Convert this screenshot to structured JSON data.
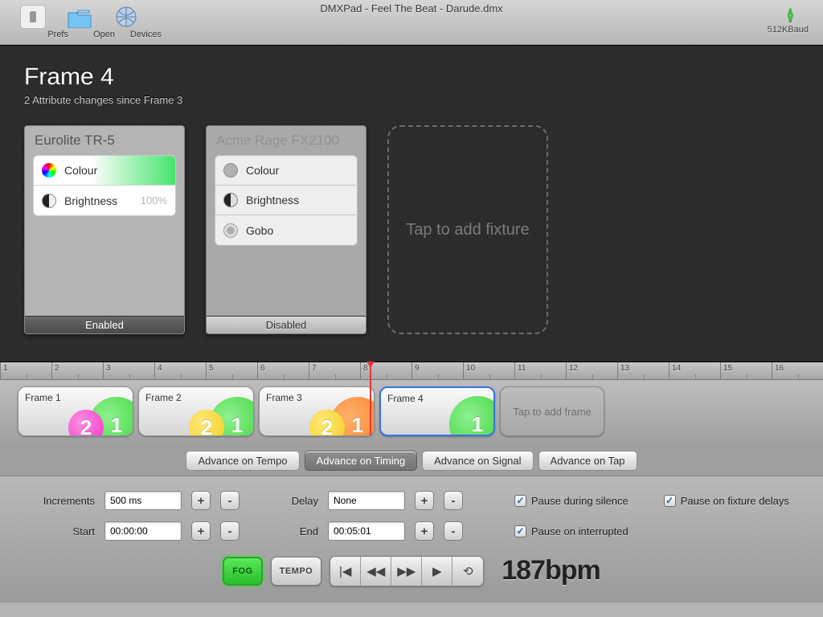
{
  "window": {
    "title": "DMXPad - Feel The Beat - Darude.dmx"
  },
  "toolbar": {
    "prefs": "Prefs",
    "open": "Open",
    "devices": "Devices",
    "baud": "512KBaud"
  },
  "frameHeader": {
    "title": "Frame 4",
    "subtitle": "2 Attribute changes since Frame 3"
  },
  "fixtures": [
    {
      "name": "Eurolite TR-5",
      "status": "Enabled",
      "rows": [
        {
          "label": "Colour",
          "value": ""
        },
        {
          "label": "Brightness",
          "value": "100%"
        }
      ]
    },
    {
      "name": "Acme Rage FX2100",
      "status": "Disabled",
      "rows": [
        {
          "label": "Colour",
          "value": ""
        },
        {
          "label": "Brightness",
          "value": ""
        },
        {
          "label": "Gobo",
          "value": ""
        }
      ]
    }
  ],
  "addFixtureLabel": "Tap to add fixture",
  "ruler": [
    "1",
    "2",
    "3",
    "4",
    "5",
    "6",
    "7",
    "8",
    "9",
    "10",
    "11",
    "12",
    "13",
    "14",
    "15",
    "16"
  ],
  "frames": [
    {
      "label": "Frame 1"
    },
    {
      "label": "Frame 2"
    },
    {
      "label": "Frame 3"
    },
    {
      "label": "Frame 4"
    }
  ],
  "frameBubbles": {
    "one": "1",
    "two": "2"
  },
  "addFrameLabel": "Tap to add frame",
  "tabs": {
    "tempo": "Advance on Tempo",
    "timing": "Advance on Timing",
    "signal": "Advance on Signal",
    "tap": "Advance on Tap"
  },
  "controls": {
    "incrementsLabel": "Increments",
    "incrementsValue": "500 ms",
    "delayLabel": "Delay",
    "delayValue": "None",
    "startLabel": "Start",
    "startValue": "00:00:00",
    "endLabel": "End",
    "endValue": "00:05:01",
    "plus": "+",
    "minus": "-",
    "chkSilence": "Pause during silence",
    "chkFixture": "Pause on fixture delays",
    "chkInterrupted": "Pause on interrupted"
  },
  "transport": {
    "fog": "FOG",
    "tempo": "TEMPO",
    "bpm": "187bpm"
  }
}
